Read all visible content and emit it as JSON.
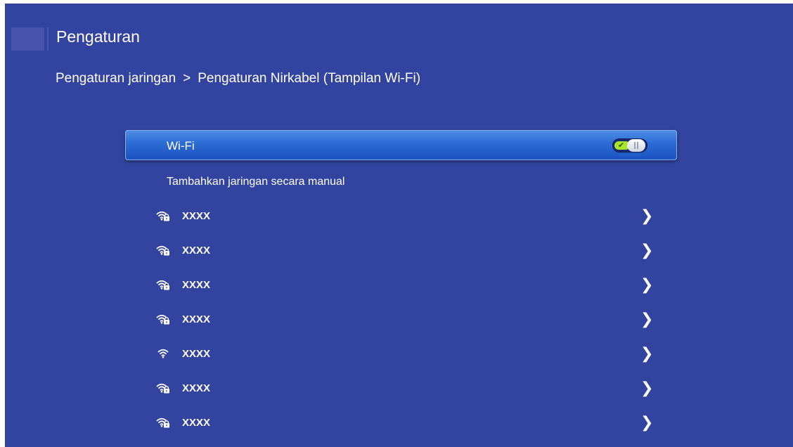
{
  "header": {
    "title": "Pengaturan"
  },
  "breadcrumb": {
    "parent": "Pengaturan jaringan",
    "separator": ">",
    "current": "Pengaturan Nirkabel (Tampilan Wi-Fi)"
  },
  "wifi_toggle": {
    "label": "Wi-Fi",
    "state": "on",
    "check_glyph": "✔"
  },
  "manual_add": {
    "label": "Tambahkan jaringan secara manual"
  },
  "networks": [
    {
      "name": "XXXX",
      "secured": true,
      "icon": "wifi-lock-icon",
      "chevron": "❯"
    },
    {
      "name": "XXXX",
      "secured": true,
      "icon": "wifi-lock-icon",
      "chevron": "❯"
    },
    {
      "name": "XXXX",
      "secured": true,
      "icon": "wifi-lock-icon",
      "chevron": "❯"
    },
    {
      "name": "XXXX",
      "secured": true,
      "icon": "wifi-lock-icon",
      "chevron": "❯"
    },
    {
      "name": "XXXX",
      "secured": false,
      "icon": "wifi-icon",
      "chevron": "❯"
    },
    {
      "name": "XXXX",
      "secured": true,
      "icon": "wifi-lock-icon",
      "chevron": "❯"
    },
    {
      "name": "XXXX",
      "secured": true,
      "icon": "wifi-lock-icon",
      "chevron": "❯"
    }
  ],
  "colors": {
    "background": "#3344a0",
    "selected_row": "#2b6bd4",
    "toggle_on": "#a8e62a",
    "text": "#ffffff"
  }
}
